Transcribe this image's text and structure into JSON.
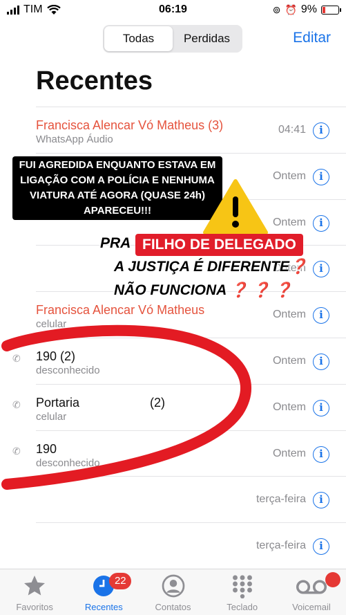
{
  "status": {
    "carrier": "TIM",
    "time": "06:19",
    "battery": "9%"
  },
  "segments": [
    "Todas",
    "Perdidas"
  ],
  "edit_label": "Editar",
  "title": "Recentes",
  "calls": [
    {
      "name": "Francisca Alencar Vó Matheus (3)",
      "sub": "WhatsApp Áudio",
      "when": "04:41",
      "missed": true
    },
    {
      "name": "",
      "sub": "",
      "when": "Ontem",
      "missed": false
    },
    {
      "name": "",
      "sub": "",
      "when": "Ontem",
      "missed": false
    },
    {
      "name": "",
      "sub": "",
      "when": "Ontem",
      "missed": false
    },
    {
      "name": "Francisca Alencar Vó Matheus",
      "sub": "celular",
      "when": "Ontem",
      "missed": true
    },
    {
      "name": "190  (2)",
      "sub": "desconhecido",
      "when": "Ontem",
      "missed": false,
      "phone": true
    },
    {
      "name": "Portaria",
      "count": "(2)",
      "sub": "celular",
      "when": "Ontem",
      "missed": false,
      "phone": true
    },
    {
      "name": "190",
      "sub": "desconhecido",
      "when": "Ontem",
      "missed": false,
      "phone": true
    },
    {
      "name": "",
      "sub": "",
      "when": "terça-feira",
      "missed": false
    },
    {
      "name": "",
      "sub": "",
      "when": "terça-feira",
      "missed": false
    }
  ],
  "overlay": {
    "complaint": "FUI AGREDIDA ENQUANTO ESTAVA EM LIGAÇÃO COM A POLÍCIA E NENHUMA VIATURA ATÉ AGORA (QUASE 24h) APARECEU!!!",
    "pra": "PRA",
    "highlight": "FILHO DE DELEGADO",
    "line2": "A JUSTIÇA É DIFERENTE",
    "line2_mark": "❓",
    "line3": "NÃO FUNCIONA",
    "line3_marks": "❓ ❓ ❓",
    "warning_icon": "warning-triangle"
  },
  "tabs": [
    {
      "label": "Favoritos",
      "icon": "star-icon"
    },
    {
      "label": "Recentes",
      "icon": "clock-icon",
      "badge": "22"
    },
    {
      "label": "Contatos",
      "icon": "person-icon"
    },
    {
      "label": "Teclado",
      "icon": "keypad-icon"
    },
    {
      "label": "Voicemail",
      "icon": "voicemail-icon"
    }
  ],
  "colors": {
    "accent": "#1a73e8",
    "missed": "#e5533d",
    "badge": "#e53935",
    "highlight": "#e11d2a",
    "circle": "#e31b23"
  }
}
